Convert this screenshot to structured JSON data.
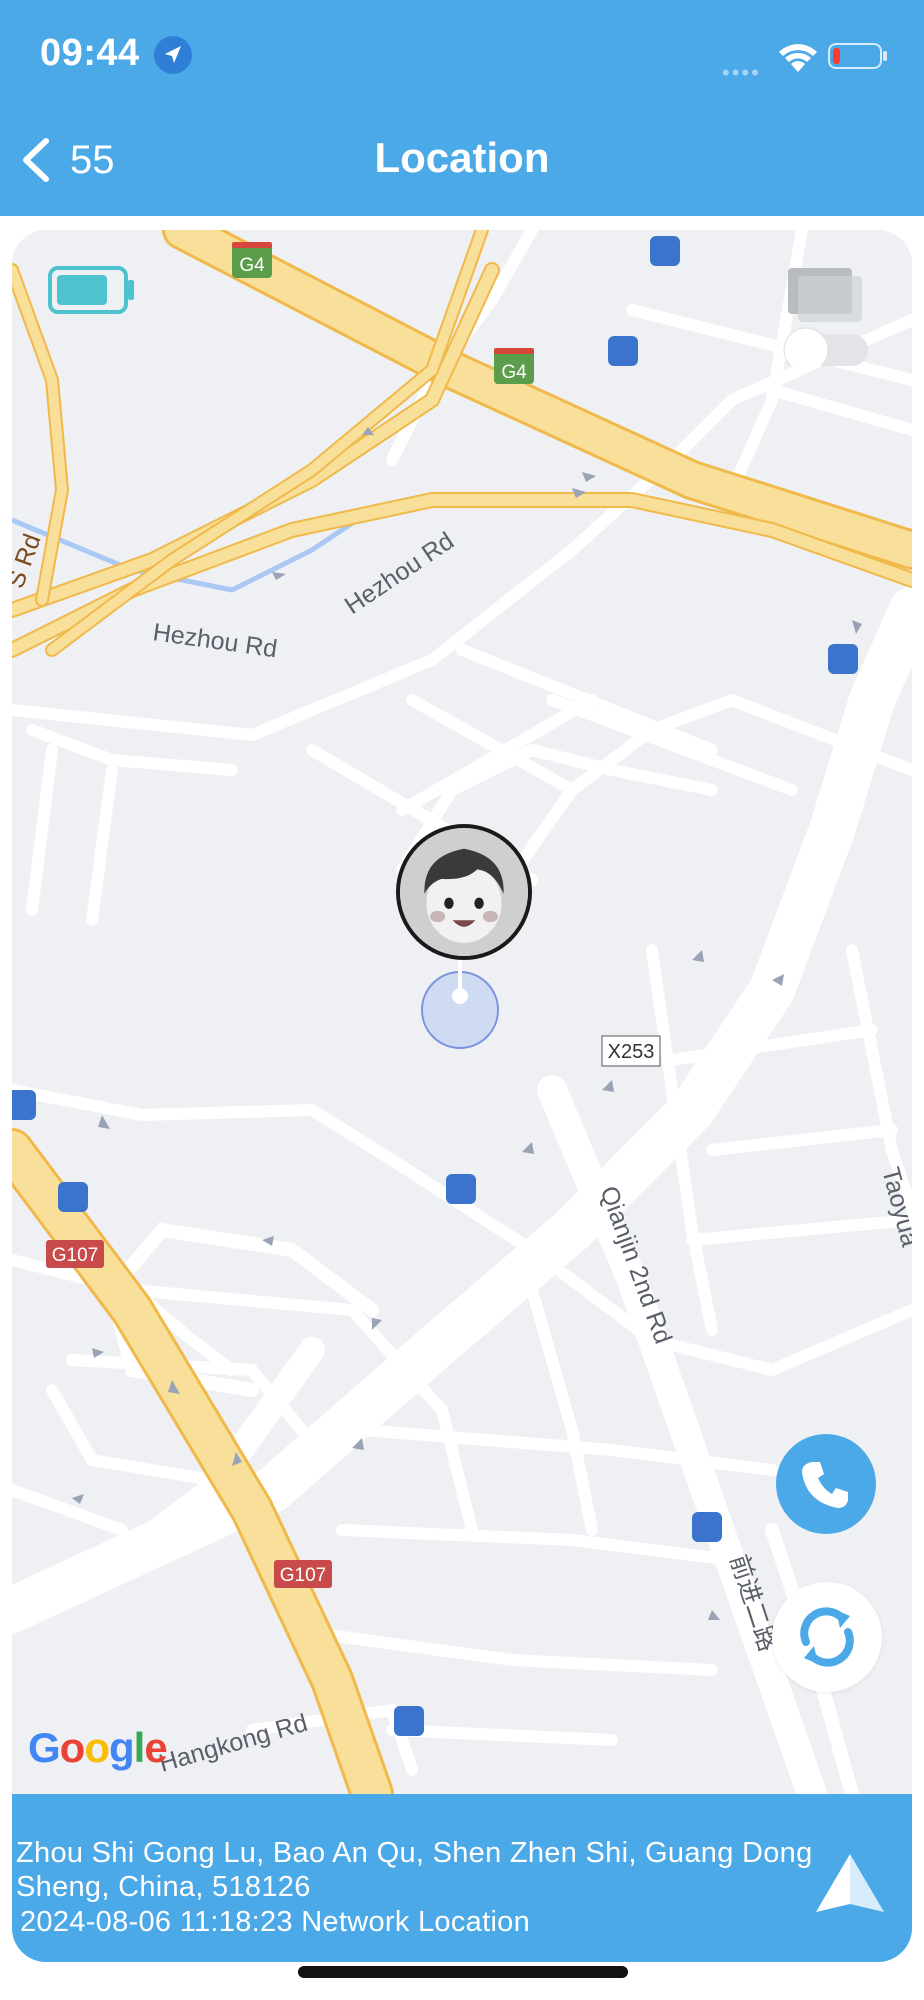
{
  "status_bar": {
    "time": "09:44",
    "signal_icon": "signal-dots",
    "wifi_icon": "wifi-icon",
    "battery_icon": "battery-low-icon"
  },
  "nav": {
    "back_count": "55",
    "title": "Location"
  },
  "map": {
    "labels": {
      "hezhou_rd_1": "Hezhou Rd",
      "hezhou_rd_2": "Hezhou Rd",
      "s_rd": "S Rd",
      "qianjin": "Qianjin 2nd Rd",
      "qianjin_cn": "前进二路",
      "hangkong": "Hangkong Rd",
      "taoyua": "Taoyua",
      "x253": "X253",
      "g4_a": "G4",
      "g4_b": "G4",
      "g107_a": "G107",
      "g107_b": "G107"
    },
    "google_letters": [
      "G",
      "o",
      "o",
      "g",
      "l",
      "e"
    ],
    "google_colors": [
      "#4285F4",
      "#EA4335",
      "#FBBC05",
      "#4285F4",
      "#34A853",
      "#EA4335"
    ]
  },
  "location": {
    "address": " Zhou Shi Gong Lu, Bao An Qu, Shen Zhen Shi, Guang Dong Sheng, China, 518126",
    "timestamp": " 2024-08-06 11:18:23 Network Location"
  },
  "colors": {
    "accent": "#4ca9e8",
    "highway": "#f8df9a",
    "highway_edge": "#f0b94a",
    "road": "#ffffff",
    "map_bg": "#eef0f3"
  }
}
